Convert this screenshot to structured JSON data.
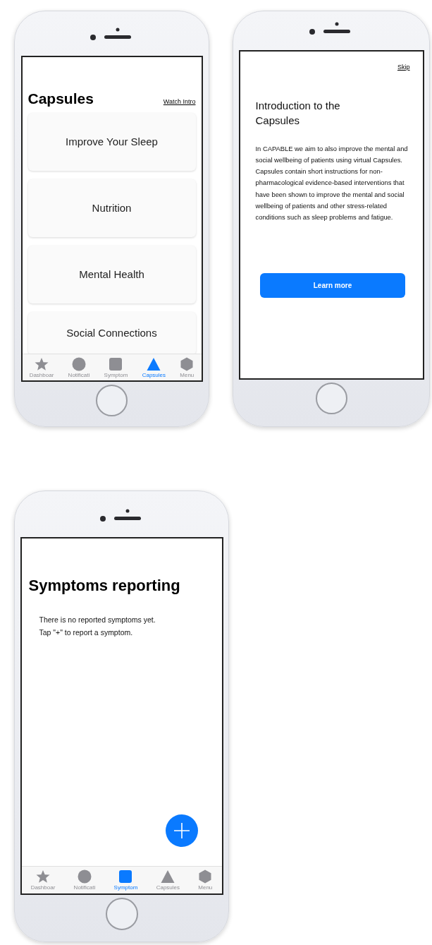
{
  "screens": [
    {
      "kind": "capsules",
      "title": "Capsules",
      "link": "Watch Intro",
      "cards": [
        "Improve Your Sleep",
        "Nutrition",
        "Mental Health",
        "Social Connections"
      ],
      "tabs": [
        {
          "kind": "star",
          "label": "Dashboar",
          "selected": false
        },
        {
          "kind": "circle",
          "label": "Notificati",
          "selected": false
        },
        {
          "kind": "square",
          "label": "Symptom",
          "selected": false
        },
        {
          "kind": "triangle",
          "label": "Capsules",
          "selected": true
        },
        {
          "kind": "hexagon",
          "label": "Menu",
          "selected": false
        }
      ]
    },
    {
      "kind": "intro",
      "skip": "Skip",
      "title": "Introduction to the Capsules",
      "body": "In CAPABLE we aim to also improve the mental and social wellbeing of patients using virtual Capsules. Capsules contain short instructions for non-pharmacological evidence-based interventions that have been shown to improve the mental and social wellbeing of patients and other stress-related conditions such as sleep problems and fatigue.",
      "button": "Learn more"
    },
    {
      "kind": "symptoms",
      "title": "Symptoms reporting",
      "message": "There is no reported symptoms yet.\nTap \"+\" to report a symptom.",
      "tabs": [
        {
          "kind": "star",
          "label": "Dashboar",
          "selected": false
        },
        {
          "kind": "circle",
          "label": "Notificati",
          "selected": false
        },
        {
          "kind": "square",
          "label": "Symptom",
          "selected": true
        },
        {
          "kind": "triangle",
          "label": "Capsules",
          "selected": false
        },
        {
          "kind": "hexagon",
          "label": "Menu",
          "selected": false
        }
      ]
    }
  ]
}
